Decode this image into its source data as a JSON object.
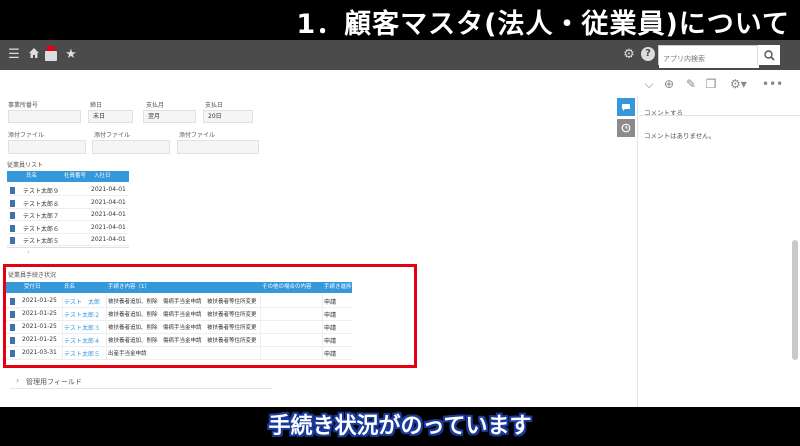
{
  "top_title": "1．顧客マスタ(法人・従業員)について",
  "header": {
    "search_placeholder": "アプリ内検索"
  },
  "form": {
    "office_no_label": "事業所番号",
    "closing_label": "締日",
    "closing_value": "末日",
    "pay_month_label": "支払月",
    "pay_month_value": "翌月",
    "pay_day_label": "支払日",
    "pay_day_value": "20日",
    "attach1_label": "添付ファイル",
    "attach2_label": "添付ファイル",
    "attach3_label": "添付ファイル"
  },
  "employee_list": {
    "title": "従業員リスト",
    "columns": [
      "氏名",
      "社員番号",
      "入社日"
    ],
    "rows": [
      {
        "name": "テスト太郎９",
        "no": "",
        "date": "2021-04-01"
      },
      {
        "name": "テスト太郎８",
        "no": "",
        "date": "2021-04-01"
      },
      {
        "name": "テスト太郎７",
        "no": "",
        "date": "2021-04-01"
      },
      {
        "name": "テスト太郎６",
        "no": "",
        "date": "2021-04-01"
      },
      {
        "name": "テスト太郎５",
        "no": "",
        "date": "2021-04-01"
      }
    ]
  },
  "procedures": {
    "title": "従業員手続き状況",
    "columns": [
      "受付日",
      "氏名",
      "手続き内容（1）",
      "その他の場合の内容",
      "手続き進捗"
    ],
    "rows": [
      {
        "date": "2021-01-25",
        "name": "テスト　太郎",
        "content": "被扶養者追加、削除　傷病手当金申請　被扶養者等住所変更",
        "other": "",
        "status": "申請"
      },
      {
        "date": "2021-01-25",
        "name": "テスト太郎２",
        "content": "被扶養者追加、削除　傷病手当金申請　被扶養者等住所変更",
        "other": "",
        "status": "申請"
      },
      {
        "date": "2021-01-25",
        "name": "テスト太郎３",
        "content": "被扶養者追加、削除　傷病手当金申請　被扶養者等住所変更",
        "other": "",
        "status": "申請"
      },
      {
        "date": "2021-01-25",
        "name": "テスト太郎４",
        "content": "被扶養者追加、削除　傷病手当金申請　被扶養者等住所変更",
        "other": "",
        "status": "申請"
      },
      {
        "date": "2021-03-31",
        "name": "テスト太郎５",
        "content": "出産手当金申請",
        "other": "",
        "status": "申請"
      }
    ]
  },
  "admin_field_label": "管理用フィールド",
  "comments": {
    "placeholder": "コメントする",
    "empty_text": "コメントはありません。"
  },
  "caption": "手続き状況がのっています",
  "colors": {
    "accent": "#3498db",
    "header_bg": "#4b4b4b",
    "highlight": "#e60012",
    "caption_outline": "#1a3a9c"
  }
}
